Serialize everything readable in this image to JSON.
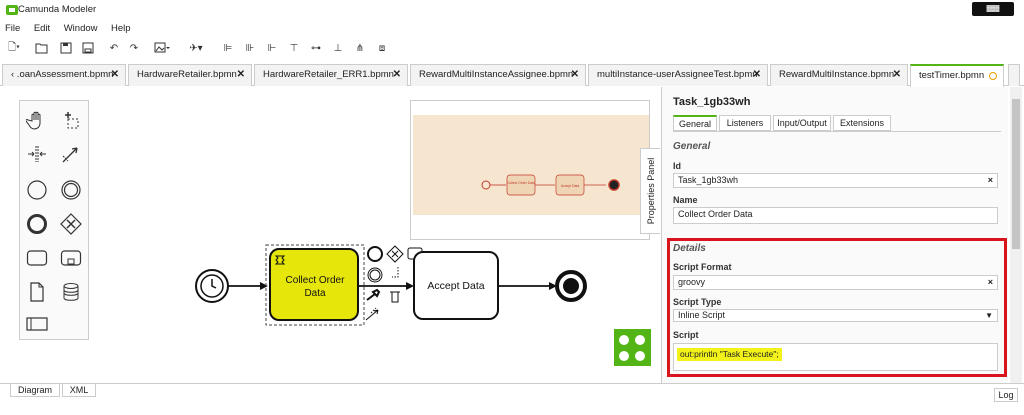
{
  "app": {
    "title": "Camunda Modeler",
    "menu": [
      "File",
      "Edit",
      "Window",
      "Help"
    ]
  },
  "tabs": [
    {
      "label": "‹ .oanAssessment.bpmn",
      "close": "✕"
    },
    {
      "label": "HardwareRetailer.bpmn",
      "close": "✕"
    },
    {
      "label": "HardwareRetailer_ERR1.bpmn",
      "close": "✕"
    },
    {
      "label": "RewardMultiInstanceAssignee.bpmn",
      "close": "✕"
    },
    {
      "label": "multiInstance-userAssigneeTest.bpmn",
      "close": "✕"
    },
    {
      "label": "RewardMultiInstance.bpmn",
      "close": "✕"
    },
    {
      "label": "testTimer.bpmn",
      "close": "○"
    }
  ],
  "diagram": {
    "task1_line1": "Collect Order",
    "task1_line2": "Data",
    "task2": "Accept Data",
    "minimap_task1": "Collect Order Data",
    "minimap_task2": "Accept Data"
  },
  "properties_toggle": "Properties Panel",
  "properties": {
    "element_id": "Task_1gb33wh",
    "tabs": [
      "General",
      "Listeners",
      "Input/Output",
      "Extensions"
    ],
    "group_general": "General",
    "id_label": "Id",
    "id_value": "Task_1gb33wh",
    "name_label": "Name",
    "name_value": "Collect Order Data",
    "group_details": "Details",
    "script_format_label": "Script Format",
    "script_format_value": "groovy",
    "script_type_label": "Script Type",
    "script_type_value": "Inline Script",
    "script_label": "Script",
    "script_value": "out:println \"Task Execute\";",
    "clear": "×",
    "dropdown_arrow": "▼"
  },
  "bottom": {
    "diagram_tab": "Diagram",
    "xml_tab": "XML",
    "log_button": "Log"
  },
  "colors": {
    "accent": "#52b415",
    "task_fill": "#e6e60b",
    "highlight": "#d8151d",
    "minimap_bg": "#f7e6cf"
  }
}
